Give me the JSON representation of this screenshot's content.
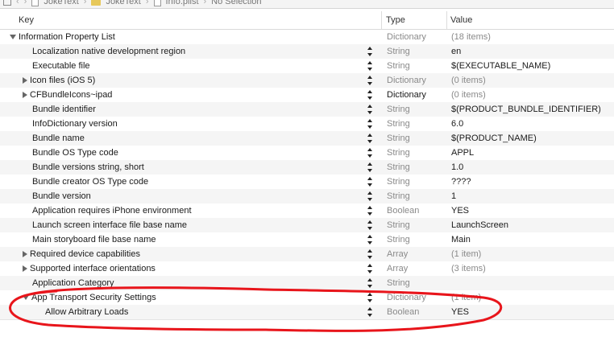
{
  "breadcrumbs": {
    "project": "JokeText",
    "group": "JokeText",
    "file": "Info.plist",
    "selection": "No Selection"
  },
  "columns": {
    "key": "Key",
    "type": "Type",
    "value": "Value"
  },
  "rows": [
    {
      "key": "Information Property List",
      "type": "Dictionary",
      "value": "(18 items)",
      "indent": 0,
      "disclosure": "down",
      "stepper": false,
      "type_dim": true,
      "value_dim": true
    },
    {
      "key": "Localization native development region",
      "type": "String",
      "value": "en",
      "indent": 1,
      "disclosure": "none",
      "stepper": true,
      "type_dim": true,
      "value_dim": false
    },
    {
      "key": "Executable file",
      "type": "String",
      "value": "$(EXECUTABLE_NAME)",
      "indent": 1,
      "disclosure": "none",
      "stepper": true,
      "type_dim": true,
      "value_dim": false
    },
    {
      "key": "Icon files (iOS 5)",
      "type": "Dictionary",
      "value": "(0 items)",
      "indent": 1,
      "disclosure": "right",
      "stepper": true,
      "type_dim": true,
      "value_dim": true
    },
    {
      "key": "CFBundleIcons~ipad",
      "type": "Dictionary",
      "value": "(0 items)",
      "indent": 1,
      "disclosure": "right",
      "stepper": true,
      "type_dim": false,
      "value_dim": true
    },
    {
      "key": "Bundle identifier",
      "type": "String",
      "value": "$(PRODUCT_BUNDLE_IDENTIFIER)",
      "indent": 1,
      "disclosure": "none",
      "stepper": true,
      "type_dim": true,
      "value_dim": false
    },
    {
      "key": "InfoDictionary version",
      "type": "String",
      "value": "6.0",
      "indent": 1,
      "disclosure": "none",
      "stepper": true,
      "type_dim": true,
      "value_dim": false
    },
    {
      "key": "Bundle name",
      "type": "String",
      "value": "$(PRODUCT_NAME)",
      "indent": 1,
      "disclosure": "none",
      "stepper": true,
      "type_dim": true,
      "value_dim": false
    },
    {
      "key": "Bundle OS Type code",
      "type": "String",
      "value": "APPL",
      "indent": 1,
      "disclosure": "none",
      "stepper": true,
      "type_dim": true,
      "value_dim": false
    },
    {
      "key": "Bundle versions string, short",
      "type": "String",
      "value": "1.0",
      "indent": 1,
      "disclosure": "none",
      "stepper": true,
      "type_dim": true,
      "value_dim": false
    },
    {
      "key": "Bundle creator OS Type code",
      "type": "String",
      "value": "????",
      "indent": 1,
      "disclosure": "none",
      "stepper": true,
      "type_dim": true,
      "value_dim": false
    },
    {
      "key": "Bundle version",
      "type": "String",
      "value": "1",
      "indent": 1,
      "disclosure": "none",
      "stepper": true,
      "type_dim": true,
      "value_dim": false
    },
    {
      "key": "Application requires iPhone environment",
      "type": "Boolean",
      "value": "YES",
      "indent": 1,
      "disclosure": "none",
      "stepper": true,
      "type_dim": true,
      "value_dim": false
    },
    {
      "key": "Launch screen interface file base name",
      "type": "String",
      "value": "LaunchScreen",
      "indent": 1,
      "disclosure": "none",
      "stepper": true,
      "type_dim": true,
      "value_dim": false
    },
    {
      "key": "Main storyboard file base name",
      "type": "String",
      "value": "Main",
      "indent": 1,
      "disclosure": "none",
      "stepper": true,
      "type_dim": true,
      "value_dim": false
    },
    {
      "key": "Required device capabilities",
      "type": "Array",
      "value": "(1 item)",
      "indent": 1,
      "disclosure": "right",
      "stepper": true,
      "type_dim": true,
      "value_dim": true
    },
    {
      "key": "Supported interface orientations",
      "type": "Array",
      "value": "(3 items)",
      "indent": 1,
      "disclosure": "right",
      "stepper": true,
      "type_dim": true,
      "value_dim": true
    },
    {
      "key": "Application Category",
      "type": "String",
      "value": "",
      "indent": 1,
      "disclosure": "none",
      "stepper": true,
      "type_dim": true,
      "value_dim": false
    },
    {
      "key": "App Transport Security Settings",
      "type": "Dictionary",
      "value": "(1 item)",
      "indent": 1,
      "disclosure": "down",
      "stepper": true,
      "type_dim": true,
      "value_dim": true
    },
    {
      "key": "Allow Arbitrary Loads",
      "type": "Boolean",
      "value": "YES",
      "indent": 2,
      "disclosure": "none",
      "stepper": true,
      "type_dim": true,
      "value_dim": false
    }
  ],
  "annotation_color": "#e8151b"
}
